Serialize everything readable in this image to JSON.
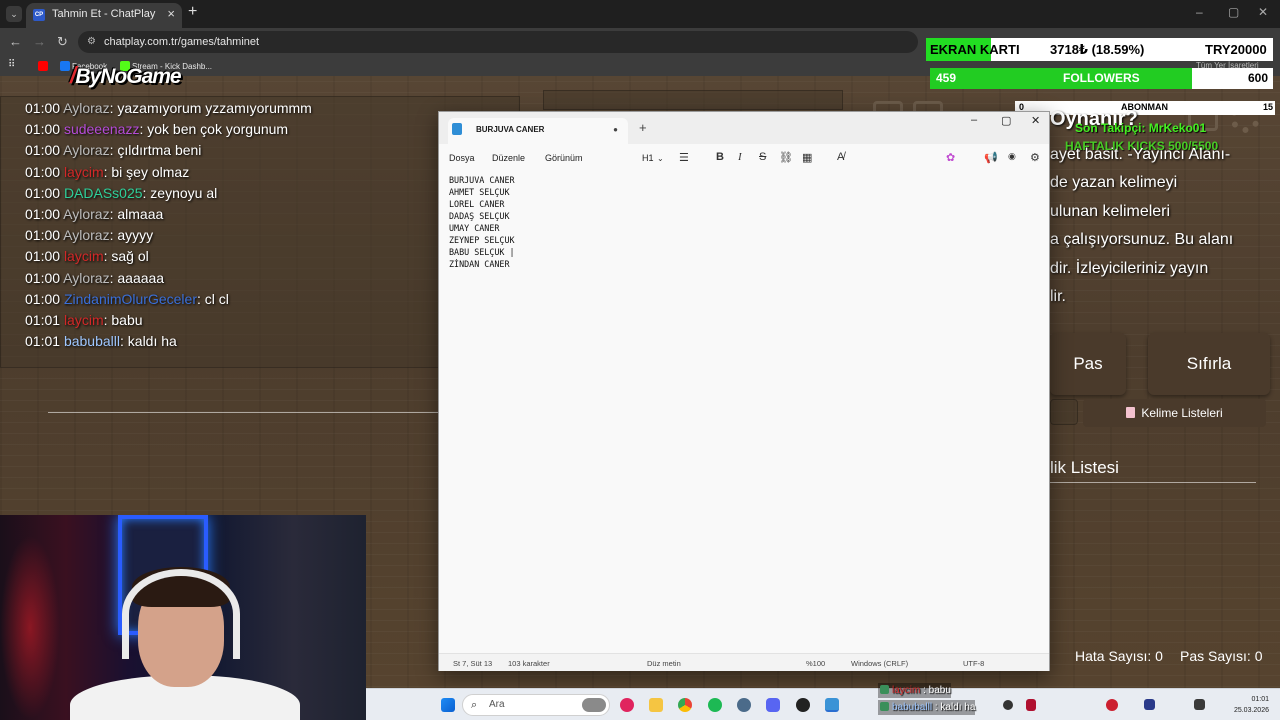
{
  "browser": {
    "tab_title": "Tahmin Et - ChatPlay",
    "tab_favicon": "CP",
    "url": "chatplay.com.tr/games/tahminet",
    "bookmarks": [
      {
        "label": "Facebook",
        "color": "#1877f2"
      },
      {
        "label": "Stream - Kick Dashb...",
        "color": "#53fc18"
      }
    ],
    "bookmarks_right": "Tüm Yer İşaretleri"
  },
  "logo": {
    "text": "ByNoGame"
  },
  "chat": [
    {
      "time": "01:00",
      "user": "Ayloraz",
      "color": "#bdbdbd",
      "msg": "yazamıyorum yzzamıyorummm"
    },
    {
      "time": "01:00",
      "user": "sudeeenazz",
      "color": "#b44bd6",
      "msg": "yok ben çok yorgunum"
    },
    {
      "time": "01:00",
      "user": "Ayloraz",
      "color": "#bdbdbd",
      "msg": "çıldırtma beni"
    },
    {
      "time": "01:00",
      "user": "laycim",
      "color": "#d12828",
      "msg": "bi şey olmaz"
    },
    {
      "time": "01:00",
      "user": "DADASs025",
      "color": "#2ecf9a",
      "msg": "zeynoyu al"
    },
    {
      "time": "01:00",
      "user": "Ayloraz",
      "color": "#bdbdbd",
      "msg": "almaaa"
    },
    {
      "time": "01:00",
      "user": "Ayloraz",
      "color": "#bdbdbd",
      "msg": "ayyyy"
    },
    {
      "time": "01:00",
      "user": "laycim",
      "color": "#d12828",
      "msg": "sağ ol"
    },
    {
      "time": "01:00",
      "user": "Ayloraz",
      "color": "#bdbdbd",
      "msg": "aaaaaa"
    },
    {
      "time": "01:00",
      "user": "ZindanimOlurGeceler",
      "color": "#3a6fd8",
      "msg": "cl cl"
    },
    {
      "time": "01:01",
      "user": "laycim",
      "color": "#d12828",
      "msg": "babu"
    },
    {
      "time": "01:01",
      "user": "babuballl",
      "color": "#9fc7ff",
      "msg": "kaldı ha"
    }
  ],
  "overlay": {
    "ekran_label": "EKRAN KARTI",
    "ekran_value": "3718₺ (18.59%)",
    "ekran_goal": "TRY20000",
    "ekran_progress": 0.1859,
    "followers_count": "459",
    "followers_label": "FOLLOWERS",
    "followers_goal": "600",
    "followers_progress": 0.765,
    "abonman_left": "0",
    "abonman_label": "ABONMAN",
    "abonman_right": "15",
    "nasil": "Oynanır?",
    "son_takipci": "Son Takipçi: MrKeko01",
    "haftalik": "HAFTALIK KICKS 500/5500"
  },
  "game": {
    "text_lines": [
      "ayet basit. -Yayıncı Alanı-",
      "de yazan kelimeyi",
      "ulunan kelimeleri",
      "a çalışıyorsunuz. Bu alanı",
      "dir. İzleyicileriniz yayın",
      "lir."
    ],
    "pas_label": "Pas",
    "sifirla_label": "Sıfırla",
    "kelime_listeleri_label": "Kelime Listeleri",
    "liste_title": "lik Listesi",
    "hata_label": "Hata Sayısı: 0",
    "pas_sayisi_label": "Pas Sayısı: 0"
  },
  "notepad": {
    "tab_title": "BURJUVA CANER",
    "menu": [
      "Dosya",
      "Düzenle",
      "Görünüm"
    ],
    "heading_select": "H1",
    "lines": [
      "BURJUVA CANER",
      "AHMET SELÇUK",
      "LOREL CANER",
      "DADAŞ SELÇUK",
      "UMAY CANER",
      "ZEYNEP SELÇUK",
      "BABU SELÇUK |",
      "ZİNDAN CANER"
    ],
    "status": {
      "position": "St 7, Süt 13",
      "chars": "103 karakter",
      "format": "Düz metin",
      "zoom": "%100",
      "eol": "Windows (CRLF)",
      "encoding": "UTF-8"
    }
  },
  "taskbar": {
    "search_placeholder": "Ara",
    "time": "01:01",
    "date": "25.03.2026"
  },
  "chatbar": [
    {
      "user": "laycim",
      "color": "#d12828",
      "msg": ": babu"
    },
    {
      "user": "babuballl",
      "color": "#9fc7ff",
      "msg": ": kaldı ha"
    }
  ]
}
